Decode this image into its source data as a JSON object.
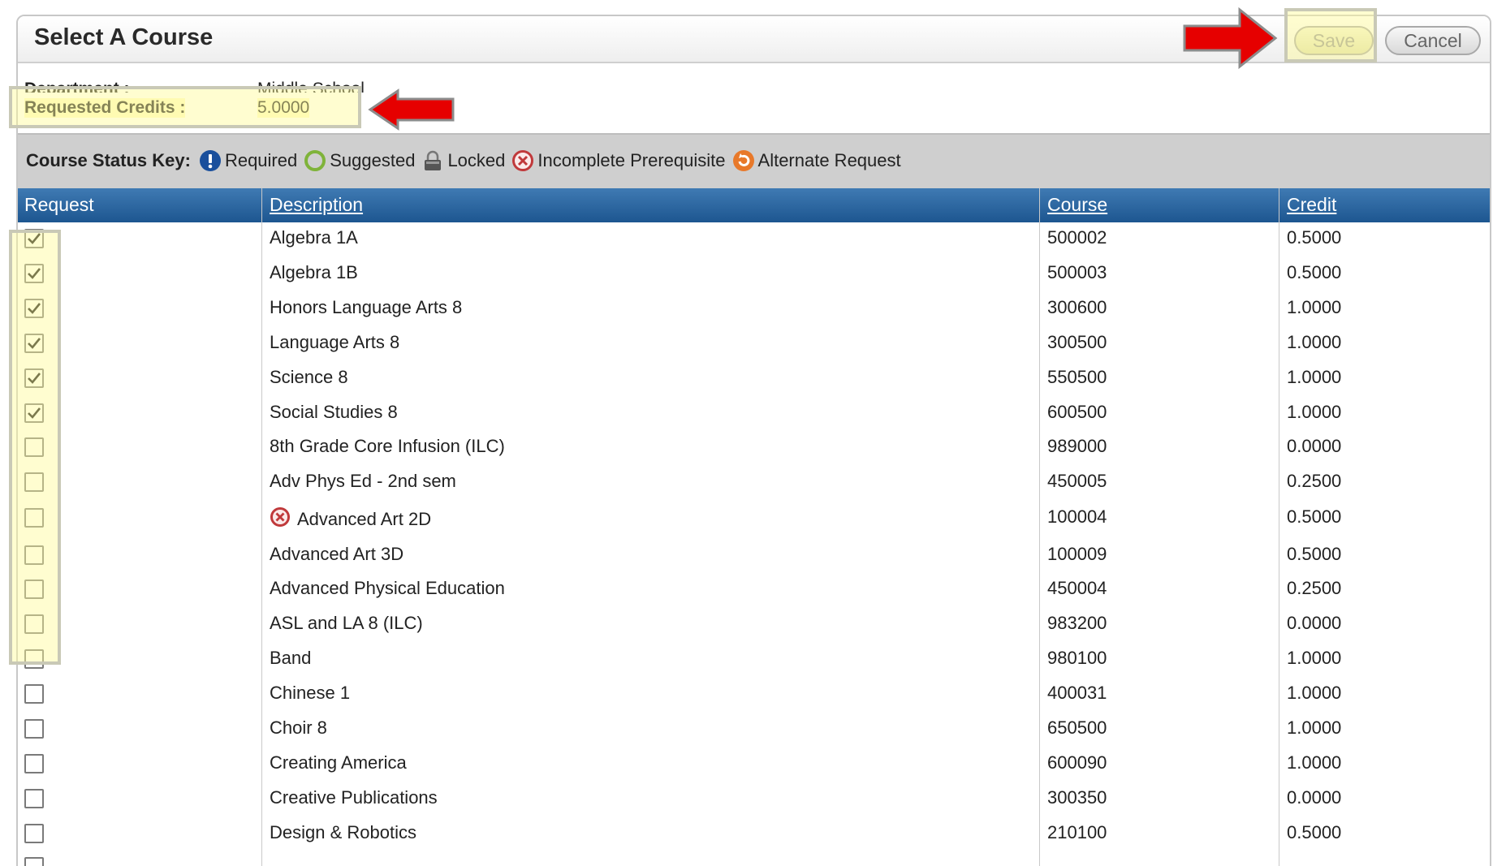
{
  "dialog": {
    "title": "Select A Course",
    "save_label": "Save",
    "cancel_label": "Cancel"
  },
  "info": {
    "department_label": "Department :",
    "department_value": "Middle School",
    "credits_label": "Requested Credits :",
    "credits_value": "5.0000"
  },
  "status_key": {
    "title": "Course Status Key:",
    "items": [
      {
        "icon": "required-icon",
        "label": "Required",
        "color": "#1a4f9c"
      },
      {
        "icon": "suggested-icon",
        "label": "Suggested",
        "color": "#7fb33a"
      },
      {
        "icon": "lock-icon",
        "label": "Locked",
        "color": "#555555"
      },
      {
        "icon": "incomplete-prerequisite-icon",
        "label": "Incomplete Prerequisite",
        "color": "#c0393b"
      },
      {
        "icon": "alternate-request-icon",
        "label": "Alternate Request",
        "color": "#e8792a"
      }
    ]
  },
  "table": {
    "columns": [
      "Request",
      "Description",
      "Course",
      "Credit"
    ],
    "rows": [
      {
        "checked": true,
        "description": "Algebra 1A",
        "course": "500002",
        "credit": "0.5000"
      },
      {
        "checked": true,
        "description": "Algebra 1B",
        "course": "500003",
        "credit": "0.5000"
      },
      {
        "checked": true,
        "description": "Honors Language Arts 8",
        "course": "300600",
        "credit": "1.0000"
      },
      {
        "checked": true,
        "description": "Language Arts 8",
        "course": "300500",
        "credit": "1.0000"
      },
      {
        "checked": true,
        "description": "Science 8",
        "course": "550500",
        "credit": "1.0000"
      },
      {
        "checked": true,
        "description": "Social Studies 8",
        "course": "600500",
        "credit": "1.0000"
      },
      {
        "checked": false,
        "description": "8th Grade Core Infusion (ILC)",
        "course": "989000",
        "credit": "0.0000"
      },
      {
        "checked": false,
        "description": "Adv Phys Ed - 2nd sem",
        "course": "450005",
        "credit": "0.2500"
      },
      {
        "checked": false,
        "description": "Advanced Art 2D",
        "course": "100004",
        "credit": "0.5000",
        "status_icon": "incomplete-prerequisite-icon"
      },
      {
        "checked": false,
        "description": "Advanced Art 3D",
        "course": "100009",
        "credit": "0.5000"
      },
      {
        "checked": false,
        "description": "Advanced Physical Education",
        "course": "450004",
        "credit": "0.2500"
      },
      {
        "checked": false,
        "description": "ASL and LA 8 (ILC)",
        "course": "983200",
        "credit": "0.0000"
      },
      {
        "checked": false,
        "description": "Band",
        "course": "980100",
        "credit": "1.0000"
      },
      {
        "checked": false,
        "description": "Chinese 1",
        "course": "400031",
        "credit": "1.0000"
      },
      {
        "checked": false,
        "description": "Choir 8",
        "course": "650500",
        "credit": "1.0000"
      },
      {
        "checked": false,
        "description": "Creating America",
        "course": "600090",
        "credit": "1.0000"
      },
      {
        "checked": false,
        "description": "Creative Publications",
        "course": "300350",
        "credit": "0.0000"
      },
      {
        "checked": false,
        "description": "Design & Robotics",
        "course": "210100",
        "credit": "0.5000"
      }
    ]
  },
  "colors": {
    "header_blue": "#1d5690",
    "highlight_yellow": "#fffa96",
    "arrow_red": "#e60000"
  }
}
